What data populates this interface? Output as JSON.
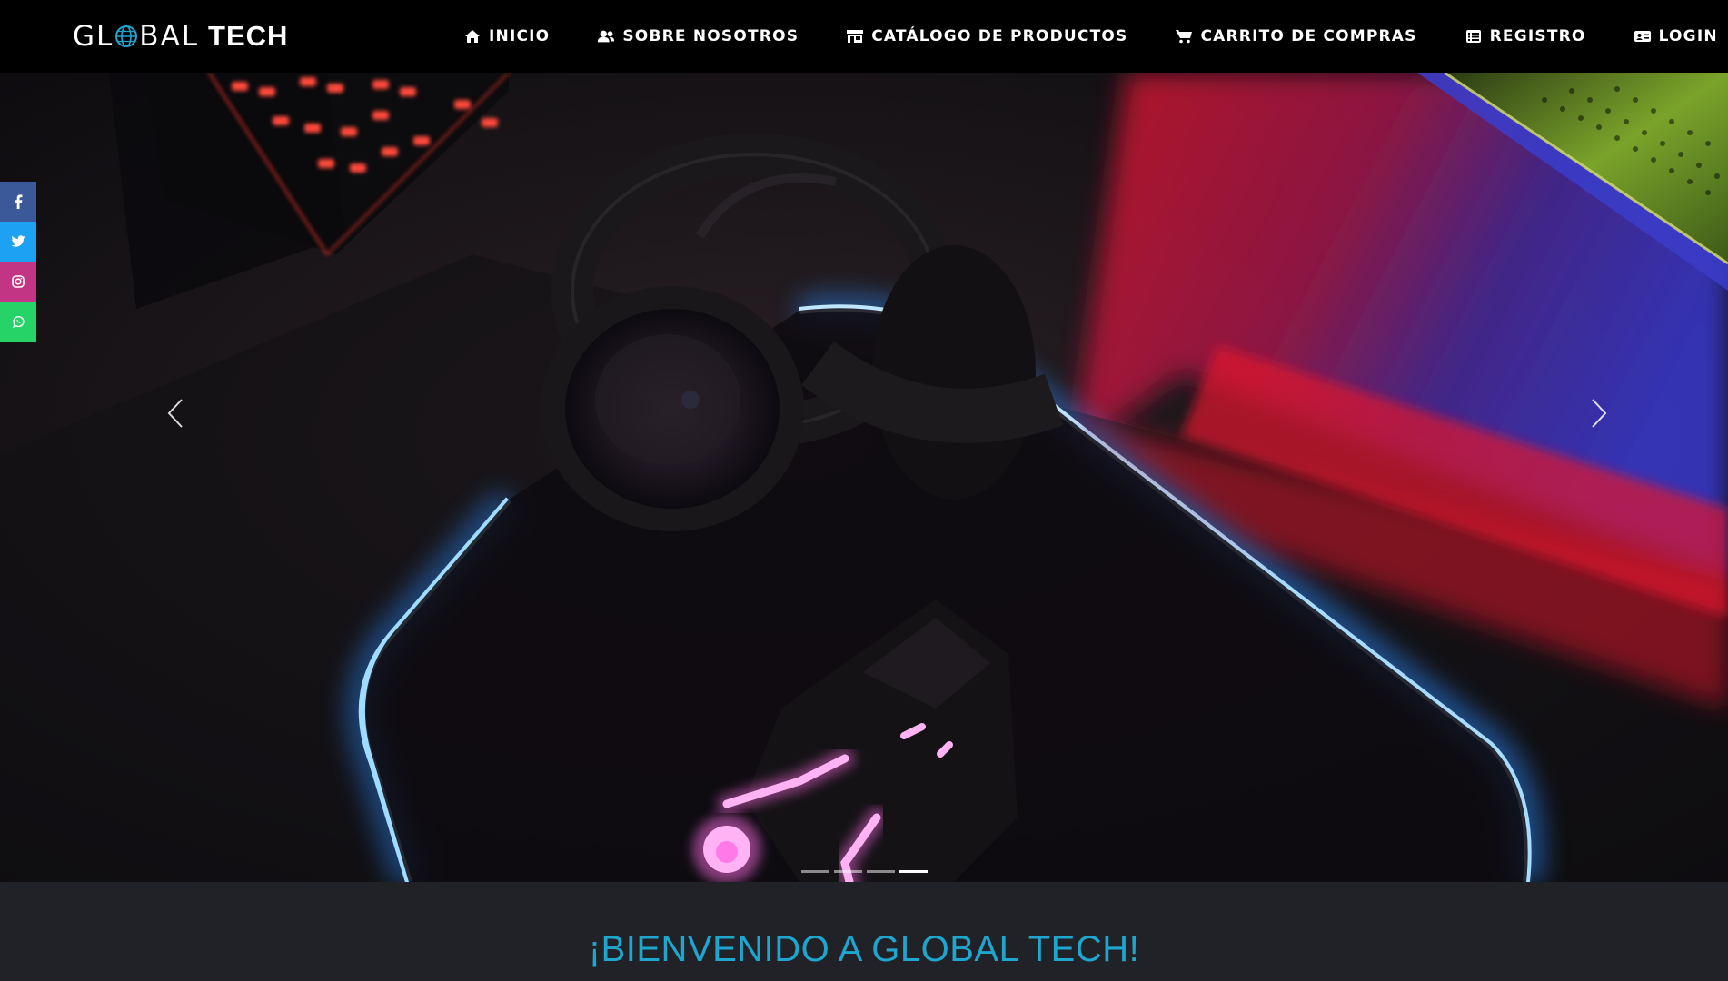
{
  "brand": {
    "light": "GL",
    "light_rest": "BAL",
    "bold": "TECH"
  },
  "nav": {
    "items": [
      {
        "label": "INICIO",
        "icon": "home-icon"
      },
      {
        "label": "SOBRE NOSOTROS",
        "icon": "users-icon"
      },
      {
        "label": "CATÁLOGO DE PRODUCTOS",
        "icon": "store-icon"
      },
      {
        "label": "CARRITO DE COMPRAS",
        "icon": "cart-icon"
      },
      {
        "label": "REGISTRO",
        "icon": "list-icon"
      },
      {
        "label": "LOGIN",
        "icon": "id-card-icon"
      }
    ]
  },
  "social": [
    {
      "name": "facebook-icon",
      "color": "#3b5998"
    },
    {
      "name": "twitter-icon",
      "color": "#1da1f2"
    },
    {
      "name": "instagram-icon",
      "color": "#c13584"
    },
    {
      "name": "whatsapp-icon",
      "color": "#25d366"
    }
  ],
  "carousel": {
    "slides": 4,
    "active_index": 3
  },
  "welcome": {
    "title": "¡BIENVENIDO A GLOBAL TECH!"
  },
  "colors": {
    "accent": "#1fa6cf",
    "navbar": "#000000",
    "section_bg": "#212227"
  }
}
